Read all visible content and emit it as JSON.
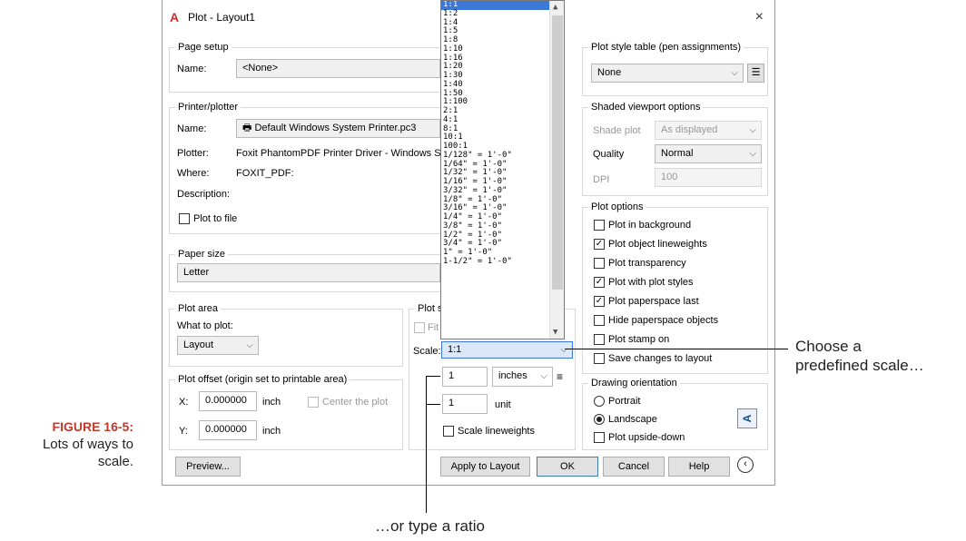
{
  "caption": {
    "figure": "FIGURE 16-5:",
    "line1": "Lots of ways to",
    "line2": "scale."
  },
  "dialog": {
    "title": "Plot - Layout1",
    "close": "×",
    "page_setup": {
      "group": "Page setup",
      "name_label": "Name:",
      "name_value": "<None>"
    },
    "printer": {
      "group": "Printer/plotter",
      "name_label": "Name:",
      "name_value": "Default Windows System Printer.pc3",
      "plotter_label": "Plotter:",
      "plotter_value": "Foxit PhantomPDF Printer Driver - Windows System",
      "where_label": "Where:",
      "where_value": "FOXIT_PDF:",
      "description_label": "Description:",
      "plot_to_file": "Plot to file"
    },
    "paper_size": {
      "group": "Paper size",
      "value": "Letter"
    },
    "plot_area": {
      "group": "Plot area",
      "what_label": "What to plot:",
      "value": "Layout"
    },
    "plot_offset": {
      "group": "Plot offset (origin set to printable area)",
      "x_label": "X:",
      "x_value": "0.000000",
      "x_unit": "inch",
      "y_label": "Y:",
      "y_value": "0.000000",
      "y_unit": "inch",
      "center": "Center the plot"
    },
    "plot_scale": {
      "group": "Plot sca",
      "fit": "Fit t",
      "scale_label": "Scale:",
      "scale_value": "1:1",
      "inches_value": "1",
      "inches_unit": "inches",
      "unit_value": "1",
      "unit_label": "unit",
      "scale_lineweights": "Scale lineweights"
    },
    "scale_options": [
      "1:1",
      "1:2",
      "1:4",
      "1:5",
      "1:8",
      "1:10",
      "1:16",
      "1:20",
      "1:30",
      "1:40",
      "1:50",
      "1:100",
      "2:1",
      "4:1",
      "8:1",
      "10:1",
      "100:1",
      "1/128\" = 1'-0\"",
      "1/64\" = 1'-0\"",
      "1/32\" = 1'-0\"",
      "1/16\" = 1'-0\"",
      "3/32\" = 1'-0\"",
      "1/8\" = 1'-0\"",
      "3/16\" = 1'-0\"",
      "1/4\" = 1'-0\"",
      "3/8\" = 1'-0\"",
      "1/2\" = 1'-0\"",
      "3/4\" = 1'-0\"",
      "1\" = 1'-0\"",
      "1-1/2\" = 1'-0\""
    ],
    "plot_style": {
      "group": "Plot style table (pen assignments)",
      "value": "None"
    },
    "shaded": {
      "group": "Shaded viewport options",
      "shade_label": "Shade plot",
      "shade_value": "As displayed",
      "quality_label": "Quality",
      "quality_value": "Normal",
      "dpi_label": "DPI",
      "dpi_value": "100"
    },
    "plot_options": {
      "group": "Plot options",
      "items": [
        {
          "label": "Plot in background",
          "checked": false
        },
        {
          "label": "Plot object lineweights",
          "checked": true
        },
        {
          "label": "Plot transparency",
          "checked": false
        },
        {
          "label": "Plot with plot styles",
          "checked": true
        },
        {
          "label": "Plot paperspace last",
          "checked": true
        },
        {
          "label": "Hide paperspace objects",
          "checked": false
        },
        {
          "label": "Plot stamp on",
          "checked": false
        },
        {
          "label": "Save changes to layout",
          "checked": false
        }
      ]
    },
    "orientation": {
      "group": "Drawing orientation",
      "portrait": "Portrait",
      "landscape": "Landscape",
      "upside_down": "Plot upside-down",
      "icon_letter": "A"
    },
    "buttons": {
      "preview": "Preview...",
      "apply": "Apply to Layout",
      "ok": "OK",
      "cancel": "Cancel",
      "help": "Help"
    }
  },
  "annotations": {
    "right_line1": "Choose a",
    "right_line2": "predefined scale…",
    "bottom": "…or type a ratio"
  }
}
